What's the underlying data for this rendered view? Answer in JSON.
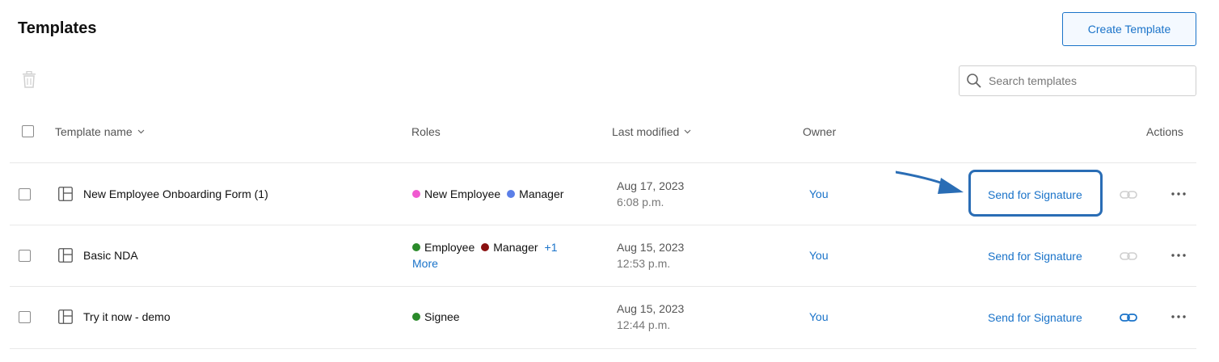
{
  "header": {
    "title": "Templates",
    "create_button": "Create Template"
  },
  "toolbar": {
    "delete_icon": "trash-icon",
    "search_placeholder": "Search templates"
  },
  "columns": {
    "name": "Template name",
    "roles": "Roles",
    "modified": "Last modified",
    "owner": "Owner",
    "actions": "Actions"
  },
  "colors": {
    "accent": "#1a73c9",
    "highlight": "#2a6db5"
  },
  "rows": [
    {
      "name": "New Employee Onboarding Form (1)",
      "roles": [
        {
          "label": "New Employee",
          "color": "#f05ad0"
        },
        {
          "label": "Manager",
          "color": "#5b7fe8"
        }
      ],
      "more": "",
      "date": "Aug 17, 2023",
      "time": "6:08 p.m.",
      "owner": "You",
      "action": "Send for Signature",
      "link_enabled": false
    },
    {
      "name": "Basic NDA",
      "roles": [
        {
          "label": "Employee",
          "color": "#2a8a2a"
        },
        {
          "label": "Manager",
          "color": "#8a1010"
        }
      ],
      "more": "+1 More",
      "date": "Aug 15, 2023",
      "time": "12:53 p.m.",
      "owner": "You",
      "action": "Send for Signature",
      "link_enabled": false
    },
    {
      "name": "Try it now - demo",
      "roles": [
        {
          "label": "Signee",
          "color": "#2a8a2a"
        }
      ],
      "more": "",
      "date": "Aug 15, 2023",
      "time": "12:44 p.m.",
      "owner": "You",
      "action": "Send for Signature",
      "link_enabled": true
    }
  ]
}
